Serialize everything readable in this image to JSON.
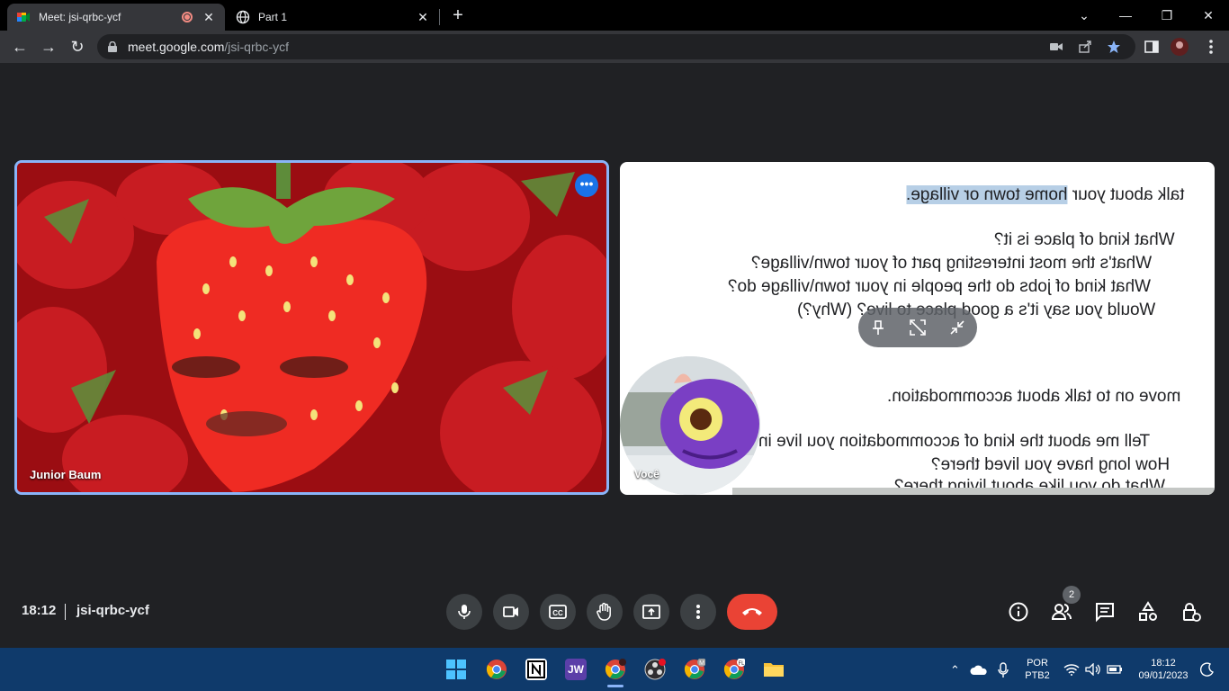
{
  "browser": {
    "tabs": [
      {
        "title": "Meet: jsi-qrbc-ycf",
        "active": true,
        "recording": true
      },
      {
        "title": "Part 1",
        "active": false
      }
    ],
    "url_domain": "meet.google.com",
    "url_path": "/jsi-qrbc-ycf"
  },
  "meeting": {
    "participants": [
      {
        "name": "Junior Baum",
        "tile": "main",
        "speaking": true
      },
      {
        "name": "Você",
        "tile": "self"
      }
    ],
    "presentation": {
      "lines": [
        {
          "text_pre": "talk about your ",
          "text_hl": "home town or village.",
          "highlight": true
        },
        {
          "text": "What kind of place is it?"
        },
        {
          "text": "What's the most interesting part of your town\\village?"
        },
        {
          "text": "What kind of jobs do the people in your town\\village do?"
        },
        {
          "text": "Would you say it's a good place to live? (Why?)"
        },
        {
          "text": "move on to talk about accommodation."
        },
        {
          "text": "Tell me about the kind of accommodation you live in"
        },
        {
          "text": "How long have you lived there?"
        },
        {
          "text": "What do you like about living there?"
        }
      ]
    },
    "time": "18:12",
    "code": "jsi-qrbc-ycf",
    "people_count": "2",
    "controls": [
      "microphone",
      "camera",
      "captions",
      "raise-hand",
      "present",
      "more-options",
      "leave-call"
    ],
    "right_controls": [
      "meeting-details",
      "people",
      "chat",
      "activities",
      "host-controls"
    ]
  },
  "taskbar": {
    "language": "POR",
    "layout": "PTB2",
    "time": "18:12",
    "date": "09/01/2023",
    "badges": {
      "chrome_m": "M",
      "chrome_fl": "FL"
    },
    "jw_label": "JW"
  },
  "colors": {
    "meet_bg": "#202124",
    "accent": "#8ab4f8",
    "end_call": "#ea4335",
    "taskbar": "#0f3a6b"
  }
}
